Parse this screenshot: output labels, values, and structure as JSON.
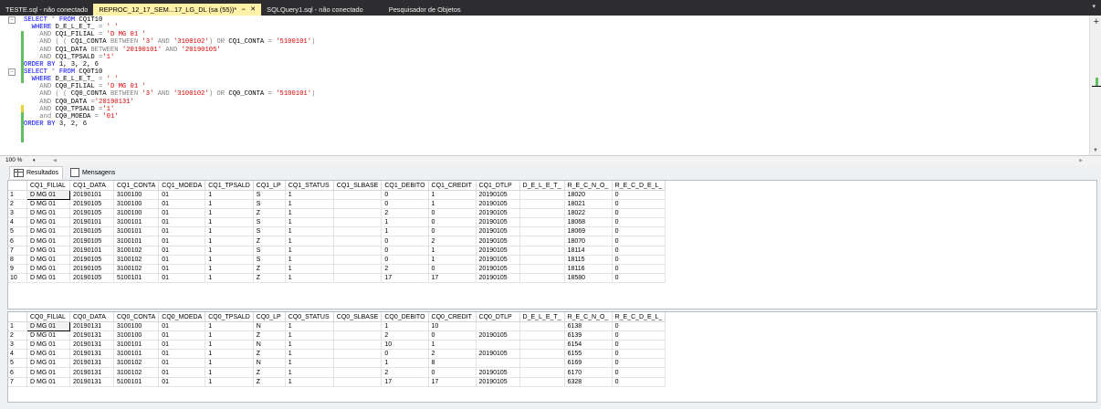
{
  "tabs": [
    {
      "label": "TESTE.sql - não conectado"
    },
    {
      "label": "REPROC_12_17_SEM...17_LG_DL (sa (55))*",
      "pin": "⇔",
      "close": "✕"
    },
    {
      "label": "SQLQuery1.sql - não conectado"
    },
    {
      "label": "Pesquisador de Objetos"
    }
  ],
  "editor": {
    "lines": [
      [
        [
          "kw",
          "SELECT"
        ],
        [
          "",
          ""
        ],
        [
          "gray",
          " *"
        ],
        [
          "kw",
          " FROM"
        ],
        [
          "",
          " CQ1T10"
        ]
      ],
      [
        [
          "",
          "  "
        ],
        [
          "kw",
          "WHERE"
        ],
        [
          "",
          " D_E_L_E_T_ "
        ],
        [
          "gray",
          "="
        ],
        [
          "str",
          " ' '"
        ]
      ],
      [
        [
          "",
          "    "
        ],
        [
          "gray",
          "AND"
        ],
        [
          "",
          " CQ1_FILIAL "
        ],
        [
          "gray",
          "="
        ],
        [
          "str",
          " 'D MG 01 '"
        ]
      ],
      [
        [
          "",
          "    "
        ],
        [
          "gray",
          "AND"
        ],
        [
          "gray",
          " ( ("
        ],
        [
          "",
          " CQ1_CONTA "
        ],
        [
          "gray",
          "BETWEEN"
        ],
        [
          "str",
          " '3'"
        ],
        [
          "gray",
          " AND"
        ],
        [
          "str",
          " '3100102'"
        ],
        [
          "gray",
          ")"
        ],
        [
          "gray",
          " OR"
        ],
        [
          "",
          " CQ1_CONTA "
        ],
        [
          "gray",
          "="
        ],
        [
          "str",
          " '5100101'"
        ],
        [
          "gray",
          ")"
        ]
      ],
      [
        [
          "",
          "    "
        ],
        [
          "gray",
          "AND"
        ],
        [
          "",
          " CQ1_DATA "
        ],
        [
          "gray",
          "BETWEEN"
        ],
        [
          "str",
          " '20190101'"
        ],
        [
          "gray",
          " AND"
        ],
        [
          "str",
          " '20190105'"
        ]
      ],
      [
        [
          "",
          "    "
        ],
        [
          "gray",
          "AND"
        ],
        [
          "",
          " CQ1_TPSALD "
        ],
        [
          "gray",
          "="
        ],
        [
          "str",
          "'1'"
        ]
      ],
      [
        [
          "kw",
          "ORDER BY"
        ],
        [
          "",
          " 1, 3, 2, 6"
        ]
      ],
      [
        [
          "kw",
          "SELECT"
        ],
        [
          "gray",
          " *"
        ],
        [
          "kw",
          " FROM"
        ],
        [
          "",
          " CQ0T10"
        ]
      ],
      [
        [
          "",
          "  "
        ],
        [
          "kw",
          "WHERE"
        ],
        [
          "",
          " D_E_L_E_T_ "
        ],
        [
          "gray",
          "="
        ],
        [
          "str",
          " ' '"
        ]
      ],
      [
        [
          "",
          "    "
        ],
        [
          "gray",
          "AND"
        ],
        [
          "",
          " CQ0_FILIAL "
        ],
        [
          "gray",
          "="
        ],
        [
          "str",
          " 'D MG 01 '"
        ]
      ],
      [
        [
          "",
          "    "
        ],
        [
          "gray",
          "AND"
        ],
        [
          "gray",
          " ( ("
        ],
        [
          "",
          " CQ0_CONTA "
        ],
        [
          "gray",
          "BETWEEN"
        ],
        [
          "str",
          " '3'"
        ],
        [
          "gray",
          " AND"
        ],
        [
          "str",
          " '3100102'"
        ],
        [
          "gray",
          ")"
        ],
        [
          "gray",
          " OR"
        ],
        [
          "",
          " CQ0_CONTA "
        ],
        [
          "gray",
          "="
        ],
        [
          "str",
          " '5100101'"
        ],
        [
          "gray",
          ")"
        ]
      ],
      [
        [
          "",
          "    "
        ],
        [
          "gray",
          "AND"
        ],
        [
          "",
          " CQ0_DATA "
        ],
        [
          "gray",
          "="
        ],
        [
          "str",
          "'20190131'"
        ]
      ],
      [
        [
          "",
          "    "
        ],
        [
          "gray",
          "AND"
        ],
        [
          "",
          " CQ0_TPSALD "
        ],
        [
          "gray",
          "="
        ],
        [
          "str",
          "'1'"
        ]
      ],
      [
        [
          "",
          "    "
        ],
        [
          "gray",
          "and"
        ],
        [
          "",
          " CQ0_MOEDA "
        ],
        [
          "gray",
          "="
        ],
        [
          "str",
          " '01'"
        ]
      ],
      [
        [
          "kw",
          "ORDER BY"
        ],
        [
          "",
          " 3, 2, 6"
        ]
      ]
    ],
    "fold_lines": [
      0,
      7
    ]
  },
  "zoom": "100 %",
  "result_tabs": [
    {
      "label": "Resultados",
      "icon": "grid-icon"
    },
    {
      "label": "Mensagens",
      "icon": "messages-icon"
    }
  ],
  "grid1": {
    "headers": [
      "CQ1_FILIAL",
      "CQ1_DATA",
      "CQ1_CONTA",
      "CQ1_MOEDA",
      "CQ1_TPSALD",
      "CQ1_LP",
      "CQ1_STATUS",
      "CQ1_SLBASE",
      "CQ1_DEBITO",
      "CQ1_CREDIT",
      "CQ1_DTLP",
      "D_E_L_E_T_",
      "R_E_C_N_O_",
      "R_E_C_D_E_L_"
    ],
    "rows": [
      [
        "1",
        "D MG 01",
        "20190101",
        "3100100",
        "01",
        "1",
        "S",
        "1",
        "",
        "0",
        "1",
        "20190105",
        "",
        "18020",
        "0"
      ],
      [
        "2",
        "D MG 01",
        "20190105",
        "3100100",
        "01",
        "1",
        "S",
        "1",
        "",
        "0",
        "1",
        "20190105",
        "",
        "18021",
        "0"
      ],
      [
        "3",
        "D MG 01",
        "20190105",
        "3100100",
        "01",
        "1",
        "Z",
        "1",
        "",
        "2",
        "0",
        "20190105",
        "",
        "18022",
        "0"
      ],
      [
        "4",
        "D MG 01",
        "20190101",
        "3100101",
        "01",
        "1",
        "S",
        "1",
        "",
        "1",
        "0",
        "20190105",
        "",
        "18068",
        "0"
      ],
      [
        "5",
        "D MG 01",
        "20190105",
        "3100101",
        "01",
        "1",
        "S",
        "1",
        "",
        "1",
        "0",
        "20190105",
        "",
        "18069",
        "0"
      ],
      [
        "6",
        "D MG 01",
        "20190105",
        "3100101",
        "01",
        "1",
        "Z",
        "1",
        "",
        "0",
        "2",
        "20190105",
        "",
        "18070",
        "0"
      ],
      [
        "7",
        "D MG 01",
        "20190101",
        "3100102",
        "01",
        "1",
        "S",
        "1",
        "",
        "0",
        "1",
        "20190105",
        "",
        "18114",
        "0"
      ],
      [
        "8",
        "D MG 01",
        "20190105",
        "3100102",
        "01",
        "1",
        "S",
        "1",
        "",
        "0",
        "1",
        "20190105",
        "",
        "18115",
        "0"
      ],
      [
        "9",
        "D MG 01",
        "20190105",
        "3100102",
        "01",
        "1",
        "Z",
        "1",
        "",
        "2",
        "0",
        "20190105",
        "",
        "18116",
        "0"
      ],
      [
        "10",
        "D MG 01",
        "20190105",
        "5100101",
        "01",
        "1",
        "Z",
        "1",
        "",
        "17",
        "17",
        "20190105",
        "",
        "18580",
        "0"
      ]
    ]
  },
  "grid2": {
    "headers": [
      "CQ0_FILIAL",
      "CQ0_DATA",
      "CQ0_CONTA",
      "CQ0_MOEDA",
      "CQ0_TPSALD",
      "CQ0_LP",
      "CQ0_STATUS",
      "CQ0_SLBASE",
      "CQ0_DEBITO",
      "CQ0_CREDIT",
      "CQ0_DTLP",
      "D_E_L_E_T_",
      "R_E_C_N_O_",
      "R_E_C_D_E_L_"
    ],
    "rows": [
      [
        "1",
        "D MG 01",
        "20190131",
        "3100100",
        "01",
        "1",
        "N",
        "1",
        "",
        "1",
        "10",
        "",
        "",
        "6138",
        "0"
      ],
      [
        "2",
        "D MG 01",
        "20190131",
        "3100100",
        "01",
        "1",
        "Z",
        "1",
        "",
        "2",
        "0",
        "20190105",
        "",
        "6139",
        "0"
      ],
      [
        "3",
        "D MG 01",
        "20190131",
        "3100101",
        "01",
        "1",
        "N",
        "1",
        "",
        "10",
        "1",
        "",
        "",
        "6154",
        "0"
      ],
      [
        "4",
        "D MG 01",
        "20190131",
        "3100101",
        "01",
        "1",
        "Z",
        "1",
        "",
        "0",
        "2",
        "20190105",
        "",
        "6155",
        "0"
      ],
      [
        "5",
        "D MG 01",
        "20190131",
        "3100102",
        "01",
        "1",
        "N",
        "1",
        "",
        "1",
        "8",
        "",
        "",
        "6169",
        "0"
      ],
      [
        "6",
        "D MG 01",
        "20190131",
        "3100102",
        "01",
        "1",
        "Z",
        "1",
        "",
        "2",
        "0",
        "20190105",
        "",
        "6170",
        "0"
      ],
      [
        "7",
        "D MG 01",
        "20190131",
        "5100101",
        "01",
        "1",
        "Z",
        "1",
        "",
        "17",
        "17",
        "20190105",
        "",
        "6328",
        "0"
      ]
    ]
  }
}
